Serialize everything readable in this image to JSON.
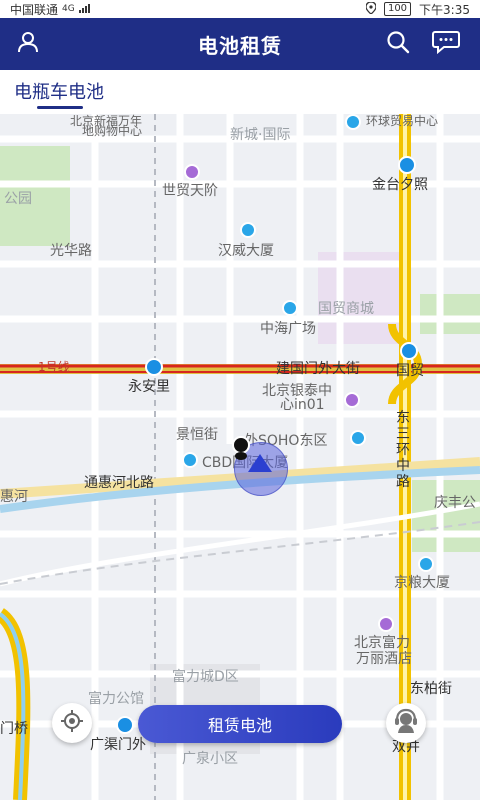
{
  "status_bar": {
    "carrier": "中国联通",
    "network": "4G",
    "battery": "100",
    "time": "下午3:35"
  },
  "header": {
    "title": "电池租赁",
    "icons": [
      "user-icon",
      "search-icon",
      "chat-icon"
    ]
  },
  "tabs": [
    {
      "label": "电瓶车电池",
      "active": true
    }
  ],
  "map": {
    "labels": {
      "shopping_center": "北京新福万年",
      "shopping_center2": "地购物中心",
      "xincheng": "新城·国际",
      "huanqiu": "环球贸易中心",
      "jintaixizhao": "金台夕照",
      "shimao": "世贸天阶",
      "park": "公园",
      "guanghua": "光华路",
      "hanwei": "汉威大厦",
      "guomao_mall": "国贸商城",
      "zhonghai": "中海广场",
      "line1": "1号线",
      "yonganli": "永安里",
      "jianguomen": "建国门外大街",
      "guomao": "国贸",
      "yintai": "北京银泰中",
      "yintai2": "心in01",
      "jinghengjie": "景恒街",
      "soho": "外SOHO东区",
      "cbd": "CBD国际大厦",
      "donsanhuan": "东三环中路",
      "tonghuihe_n": "通惠河北路",
      "tonghuihe": "惠河",
      "qingfeng": "庆丰公",
      "jingliang": "京粮大厦",
      "fuli": "北京富力",
      "fuli2": "万丽酒店",
      "fuli_d": "富力城D区",
      "fuli_gongyu": "富力公馆",
      "dongbaijie": "东柏街",
      "guangqumen": "广渠门外",
      "guangquan": "广泉小区",
      "shuangjing": "双井",
      "menqiao": "门桥"
    }
  },
  "actions": {
    "rent_battery": "租赁电池",
    "locate_icon": "locate-icon",
    "support_icon": "customer-service-icon"
  },
  "colors": {
    "header_bg": "#1f2e86",
    "cta_bg": "#3a49c9",
    "map_bg": "#eef0f4"
  }
}
